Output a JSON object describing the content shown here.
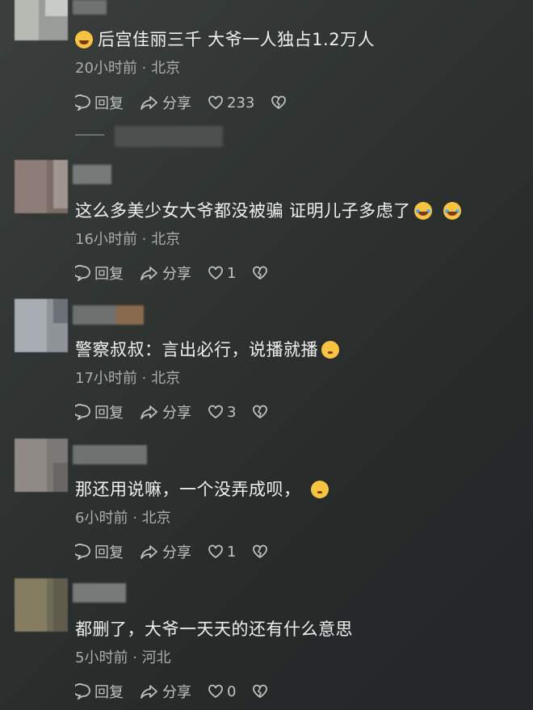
{
  "comments": [
    {
      "text": "后宫佳丽三千  大爷一人独占1.2万人",
      "emoji_before": "laughing-tears-emoji",
      "time": "20小时前",
      "location": "北京",
      "reply": "回复",
      "share": "分享",
      "likes": "233"
    },
    {
      "text": "这么多美少女大爷都没被骗  证明儿子多虑了",
      "emoji_after": [
        "laughing-tears-emoji",
        "laughing-tears-emoji"
      ],
      "time": "16小时前",
      "location": "北京",
      "reply": "回复",
      "share": "分享",
      "likes": "1"
    },
    {
      "text": "警察叔叔：言出必行，说播就播",
      "emoji_after": [
        "thinking-emoji"
      ],
      "time": "17小时前",
      "location": "北京",
      "reply": "回复",
      "share": "分享",
      "likes": "3"
    },
    {
      "text": "那还用说嘛，一个没弄成呗，",
      "emoji_after": [
        "thinking-emoji"
      ],
      "time": "6小时前",
      "location": "北京",
      "reply": "回复",
      "share": "分享",
      "likes": "1"
    },
    {
      "text": "都删了，大爷一天天的还有什么意思",
      "time": "5小时前",
      "location": "河北",
      "reply": "回复",
      "share": "分享",
      "likes": "0"
    }
  ],
  "separator": "·"
}
